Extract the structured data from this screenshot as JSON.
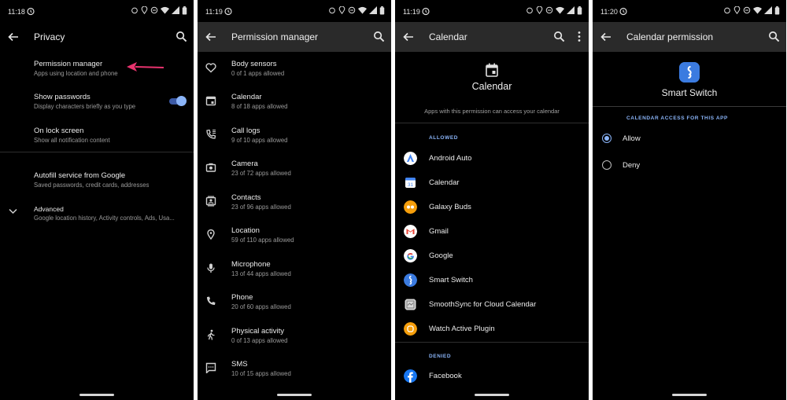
{
  "screens": [
    {
      "status_time": "11:18",
      "title": "Privacy",
      "items": [
        {
          "title": "Permission manager",
          "subtitle": "Apps using location and phone"
        },
        {
          "title": "Show passwords",
          "subtitle": "Display characters briefly as you type"
        },
        {
          "title": "On lock screen",
          "subtitle": "Show all notification content"
        },
        {
          "title": "Autofill service from Google",
          "subtitle": "Saved passwords, credit cards, addresses"
        },
        {
          "title": "Advanced",
          "subtitle": "Google location history, Activity controls, Ads, Usa..."
        }
      ],
      "show_passwords_enabled": true
    },
    {
      "status_time": "11:19",
      "title": "Permission manager",
      "items": [
        {
          "icon": "heart-icon",
          "title": "Body sensors",
          "subtitle": "0 of 1 apps allowed"
        },
        {
          "icon": "calendar-icon",
          "title": "Calendar",
          "subtitle": "8 of 18 apps allowed"
        },
        {
          "icon": "call-log-icon",
          "title": "Call logs",
          "subtitle": "9 of 10 apps allowed"
        },
        {
          "icon": "camera-icon",
          "title": "Camera",
          "subtitle": "23 of 72 apps allowed"
        },
        {
          "icon": "contacts-icon",
          "title": "Contacts",
          "subtitle": "23 of 96 apps allowed"
        },
        {
          "icon": "location-icon",
          "title": "Location",
          "subtitle": "59 of 110 apps allowed"
        },
        {
          "icon": "microphone-icon",
          "title": "Microphone",
          "subtitle": "13 of 44 apps allowed"
        },
        {
          "icon": "phone-icon",
          "title": "Phone",
          "subtitle": "20 of 60 apps allowed"
        },
        {
          "icon": "walk-icon",
          "title": "Physical activity",
          "subtitle": "0 of 13 apps allowed"
        },
        {
          "icon": "sms-icon",
          "title": "SMS",
          "subtitle": "10 of 15 apps allowed"
        }
      ]
    },
    {
      "status_time": "11:19",
      "title": "Calendar",
      "header_title": "Calendar",
      "description": "Apps with this permission can access your calendar",
      "allowed_label": "ALLOWED",
      "allowed_apps": [
        {
          "name": "Android Auto",
          "color": "#ffffff"
        },
        {
          "name": "Calendar",
          "color": "#ffffff"
        },
        {
          "name": "Galaxy Buds",
          "color": "#f59e0b"
        },
        {
          "name": "Gmail",
          "color": "#ffffff"
        },
        {
          "name": "Google",
          "color": "#ffffff"
        },
        {
          "name": "Smart Switch",
          "color": "#3b7be0"
        },
        {
          "name": "SmoothSync for Cloud Calendar",
          "color": "#d9d9d9"
        },
        {
          "name": "Watch Active Plugin",
          "color": "#f59e0b"
        }
      ],
      "denied_label": "DENIED",
      "denied_apps": [
        {
          "name": "Facebook",
          "color": "#1877f2"
        }
      ]
    },
    {
      "status_time": "11:20",
      "title": "Calendar permission",
      "app_name": "Smart Switch",
      "section_label": "CALENDAR ACCESS FOR THIS APP",
      "options": [
        {
          "label": "Allow",
          "selected": true
        },
        {
          "label": "Deny",
          "selected": false
        }
      ]
    }
  ],
  "colors": {
    "accent": "#8ab4f8",
    "arrow": "#e8336e",
    "background": "#000000"
  }
}
